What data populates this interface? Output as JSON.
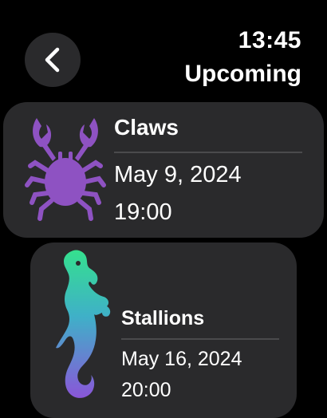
{
  "header": {
    "time": "13:45",
    "title": "Upcoming"
  },
  "events": [
    {
      "team": "Claws",
      "date": "May 9, 2024",
      "time": "19:00",
      "icon": "crab-icon",
      "icon_color": "#8e52c2"
    },
    {
      "team": "Stallions",
      "date": "May 16, 2024",
      "time": "20:00",
      "icon": "seahorse-icon",
      "icon_gradient": [
        "#35e08e",
        "#8a56d8"
      ]
    }
  ],
  "colors": {
    "background": "#000000",
    "card": "#2a2a2c",
    "text": "#ffffff",
    "divider": "#4a4a4c"
  }
}
